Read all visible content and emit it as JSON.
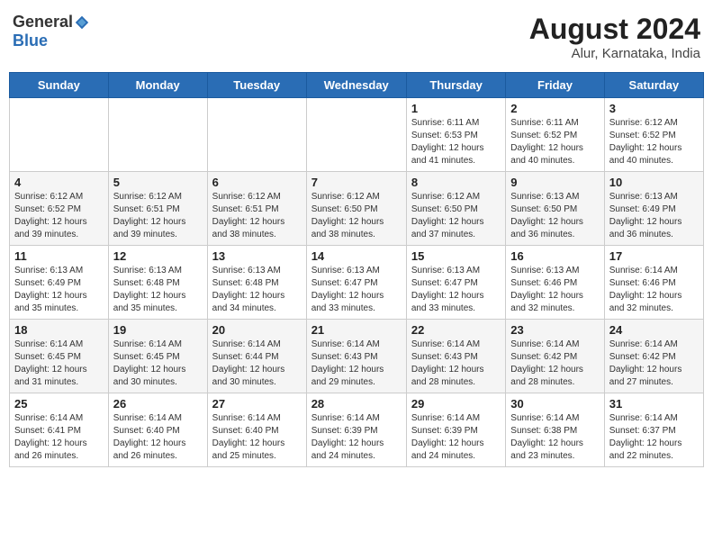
{
  "logo": {
    "general": "General",
    "blue": "Blue"
  },
  "header": {
    "month_year": "August 2024",
    "location": "Alur, Karnataka, India"
  },
  "weekdays": [
    "Sunday",
    "Monday",
    "Tuesday",
    "Wednesday",
    "Thursday",
    "Friday",
    "Saturday"
  ],
  "weeks": [
    [
      {
        "day": "",
        "info": ""
      },
      {
        "day": "",
        "info": ""
      },
      {
        "day": "",
        "info": ""
      },
      {
        "day": "",
        "info": ""
      },
      {
        "day": "1",
        "info": "Sunrise: 6:11 AM\nSunset: 6:53 PM\nDaylight: 12 hours\nand 41 minutes."
      },
      {
        "day": "2",
        "info": "Sunrise: 6:11 AM\nSunset: 6:52 PM\nDaylight: 12 hours\nand 40 minutes."
      },
      {
        "day": "3",
        "info": "Sunrise: 6:12 AM\nSunset: 6:52 PM\nDaylight: 12 hours\nand 40 minutes."
      }
    ],
    [
      {
        "day": "4",
        "info": "Sunrise: 6:12 AM\nSunset: 6:52 PM\nDaylight: 12 hours\nand 39 minutes."
      },
      {
        "day": "5",
        "info": "Sunrise: 6:12 AM\nSunset: 6:51 PM\nDaylight: 12 hours\nand 39 minutes."
      },
      {
        "day": "6",
        "info": "Sunrise: 6:12 AM\nSunset: 6:51 PM\nDaylight: 12 hours\nand 38 minutes."
      },
      {
        "day": "7",
        "info": "Sunrise: 6:12 AM\nSunset: 6:50 PM\nDaylight: 12 hours\nand 38 minutes."
      },
      {
        "day": "8",
        "info": "Sunrise: 6:12 AM\nSunset: 6:50 PM\nDaylight: 12 hours\nand 37 minutes."
      },
      {
        "day": "9",
        "info": "Sunrise: 6:13 AM\nSunset: 6:50 PM\nDaylight: 12 hours\nand 36 minutes."
      },
      {
        "day": "10",
        "info": "Sunrise: 6:13 AM\nSunset: 6:49 PM\nDaylight: 12 hours\nand 36 minutes."
      }
    ],
    [
      {
        "day": "11",
        "info": "Sunrise: 6:13 AM\nSunset: 6:49 PM\nDaylight: 12 hours\nand 35 minutes."
      },
      {
        "day": "12",
        "info": "Sunrise: 6:13 AM\nSunset: 6:48 PM\nDaylight: 12 hours\nand 35 minutes."
      },
      {
        "day": "13",
        "info": "Sunrise: 6:13 AM\nSunset: 6:48 PM\nDaylight: 12 hours\nand 34 minutes."
      },
      {
        "day": "14",
        "info": "Sunrise: 6:13 AM\nSunset: 6:47 PM\nDaylight: 12 hours\nand 33 minutes."
      },
      {
        "day": "15",
        "info": "Sunrise: 6:13 AM\nSunset: 6:47 PM\nDaylight: 12 hours\nand 33 minutes."
      },
      {
        "day": "16",
        "info": "Sunrise: 6:13 AM\nSunset: 6:46 PM\nDaylight: 12 hours\nand 32 minutes."
      },
      {
        "day": "17",
        "info": "Sunrise: 6:14 AM\nSunset: 6:46 PM\nDaylight: 12 hours\nand 32 minutes."
      }
    ],
    [
      {
        "day": "18",
        "info": "Sunrise: 6:14 AM\nSunset: 6:45 PM\nDaylight: 12 hours\nand 31 minutes."
      },
      {
        "day": "19",
        "info": "Sunrise: 6:14 AM\nSunset: 6:45 PM\nDaylight: 12 hours\nand 30 minutes."
      },
      {
        "day": "20",
        "info": "Sunrise: 6:14 AM\nSunset: 6:44 PM\nDaylight: 12 hours\nand 30 minutes."
      },
      {
        "day": "21",
        "info": "Sunrise: 6:14 AM\nSunset: 6:43 PM\nDaylight: 12 hours\nand 29 minutes."
      },
      {
        "day": "22",
        "info": "Sunrise: 6:14 AM\nSunset: 6:43 PM\nDaylight: 12 hours\nand 28 minutes."
      },
      {
        "day": "23",
        "info": "Sunrise: 6:14 AM\nSunset: 6:42 PM\nDaylight: 12 hours\nand 28 minutes."
      },
      {
        "day": "24",
        "info": "Sunrise: 6:14 AM\nSunset: 6:42 PM\nDaylight: 12 hours\nand 27 minutes."
      }
    ],
    [
      {
        "day": "25",
        "info": "Sunrise: 6:14 AM\nSunset: 6:41 PM\nDaylight: 12 hours\nand 26 minutes."
      },
      {
        "day": "26",
        "info": "Sunrise: 6:14 AM\nSunset: 6:40 PM\nDaylight: 12 hours\nand 26 minutes."
      },
      {
        "day": "27",
        "info": "Sunrise: 6:14 AM\nSunset: 6:40 PM\nDaylight: 12 hours\nand 25 minutes."
      },
      {
        "day": "28",
        "info": "Sunrise: 6:14 AM\nSunset: 6:39 PM\nDaylight: 12 hours\nand 24 minutes."
      },
      {
        "day": "29",
        "info": "Sunrise: 6:14 AM\nSunset: 6:39 PM\nDaylight: 12 hours\nand 24 minutes."
      },
      {
        "day": "30",
        "info": "Sunrise: 6:14 AM\nSunset: 6:38 PM\nDaylight: 12 hours\nand 23 minutes."
      },
      {
        "day": "31",
        "info": "Sunrise: 6:14 AM\nSunset: 6:37 PM\nDaylight: 12 hours\nand 22 minutes."
      }
    ]
  ]
}
